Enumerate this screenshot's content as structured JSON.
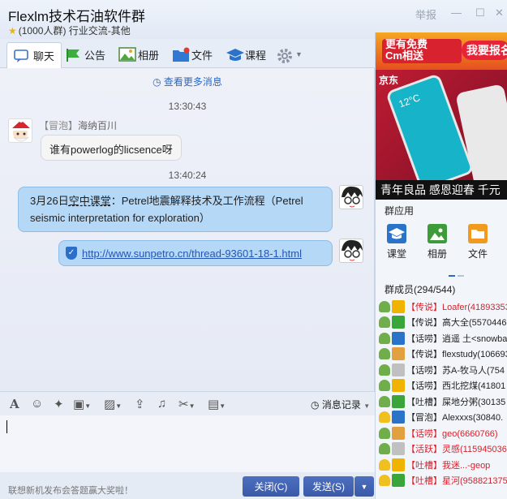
{
  "window": {
    "title": "Flexlm技术石油软件群",
    "subtitle": "(1000人群)  行业交流-其他",
    "report": "举报"
  },
  "tabs": [
    {
      "label": "聊天",
      "active": true
    },
    {
      "label": "公告"
    },
    {
      "label": "相册"
    },
    {
      "label": "文件"
    },
    {
      "label": "课程"
    }
  ],
  "chat": {
    "more_label": "查看更多消息",
    "messages": [
      {
        "time": "13:30:43",
        "sender_tag": "【冒泡】",
        "sender": "海纳百川",
        "text": "谁有powerlog的licsence呀"
      },
      {
        "time": "13:40:24",
        "text_a": "3月26日",
        "text_b": "空中课堂",
        "text_c": "：Petrel地震解释技术及工作流程（Petrel seismic interpretation for exploration）"
      },
      {
        "link": "http://www.sunpetro.cn/thread-93601-18-1.html"
      }
    ]
  },
  "toolbar": {
    "history_label": "消息记录"
  },
  "bottom": {
    "notice": "联想新机发布会答题赢大奖啦！",
    "close_label": "关闭(C)",
    "send_label": "发送(S)"
  },
  "ad": {
    "badge1": "更有免费",
    "badge1b": "Cm相送",
    "badge2": "我要报名",
    "brand": "京东",
    "clock": "12°C",
    "bottom_text": "青年良品 感恩迎春 千元"
  },
  "apps": {
    "title": "群应用",
    "items": [
      {
        "label": "课堂"
      },
      {
        "label": "相册"
      },
      {
        "label": "文件"
      }
    ]
  },
  "members": {
    "title": "群成员(294/544)",
    "list": [
      {
        "text": "【传说】Loafer(41893353",
        "red": true
      },
      {
        "text": "【传说】高大全(5570446",
        "red": false
      },
      {
        "text": "【话唠】逍遥 土<snowba",
        "red": false
      },
      {
        "text": "【传说】flexstudy(106693",
        "red": false
      },
      {
        "text": "【话唠】苏A-牧马人(754",
        "red": false
      },
      {
        "text": "【话唠】西北挖煤(41801",
        "red": false
      },
      {
        "text": "【吐槽】屎地分粥(30135",
        "red": false
      },
      {
        "text": "【冒泡】Alexxxs(30840.",
        "red": false
      },
      {
        "text": "【话唠】geo(6660766)",
        "red": true
      },
      {
        "text": "【活跃】灵感(1159450368",
        "red": true
      },
      {
        "text": "【吐槽】我迷...-geop",
        "red": true
      },
      {
        "text": "【吐槽】星河(958821375",
        "red": true
      }
    ]
  },
  "colors": {
    "accent": "#2a69c4",
    "bubble_out": "#b5d8f7",
    "send_button": "#3a5aa8",
    "member_red": "#d9212b"
  }
}
